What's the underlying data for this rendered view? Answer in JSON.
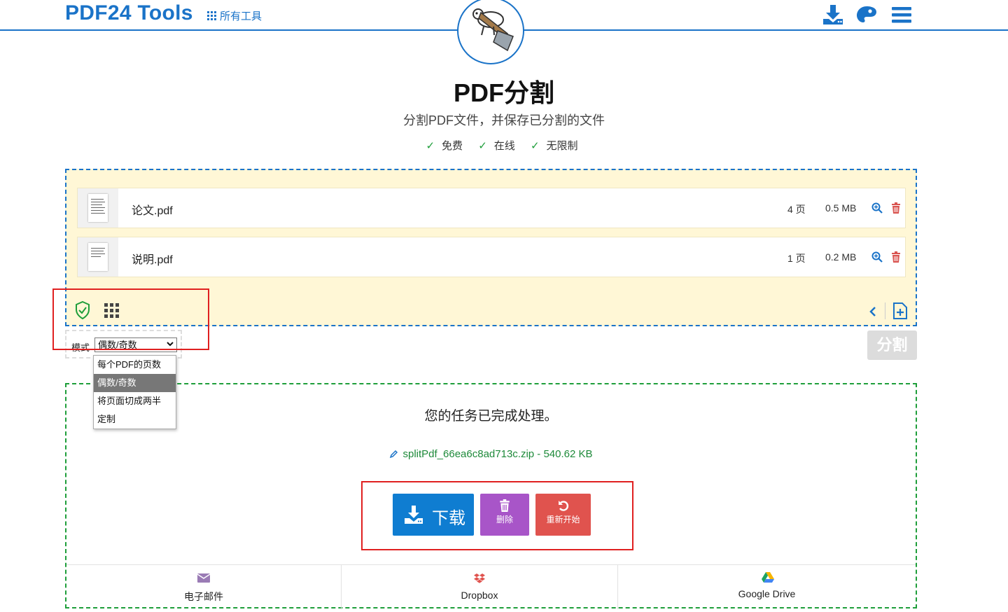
{
  "header": {
    "logo": "PDF24 Tools",
    "all_tools": "所有工具",
    "icons": [
      "download-app-icon",
      "palette-icon",
      "menu-icon"
    ]
  },
  "page": {
    "title": "PDF分割",
    "subtitle": "分割PDF文件，并保存已分割的文件",
    "features": [
      "免费",
      "在线",
      "无限制"
    ]
  },
  "files": [
    {
      "name": "论文.pdf",
      "pages": "4 页",
      "size": "0.5 MB"
    },
    {
      "name": "说明.pdf",
      "pages": "1 页",
      "size": "0.2 MB"
    }
  ],
  "mode": {
    "label": "模式",
    "selected": "偶数/奇数",
    "options": [
      "每个PDF的页数",
      "偶数/奇数",
      "将页面切成两半",
      "定制"
    ]
  },
  "split_button": "分割",
  "result": {
    "message": "您的任务已完成处理。",
    "file": "splitPdf_66ea6c8ad713c.zip - 540.62 KB",
    "download": "下载",
    "delete": "删除",
    "restart": "重新开始"
  },
  "share": [
    "电子邮件",
    "Dropbox",
    "Google Drive"
  ],
  "colors": {
    "brand": "#1a73c8",
    "download": "#0f7dd1",
    "delete": "#a855c8",
    "restart": "#e0534e",
    "success": "#1e9e3a",
    "annotation": "#e02020"
  }
}
